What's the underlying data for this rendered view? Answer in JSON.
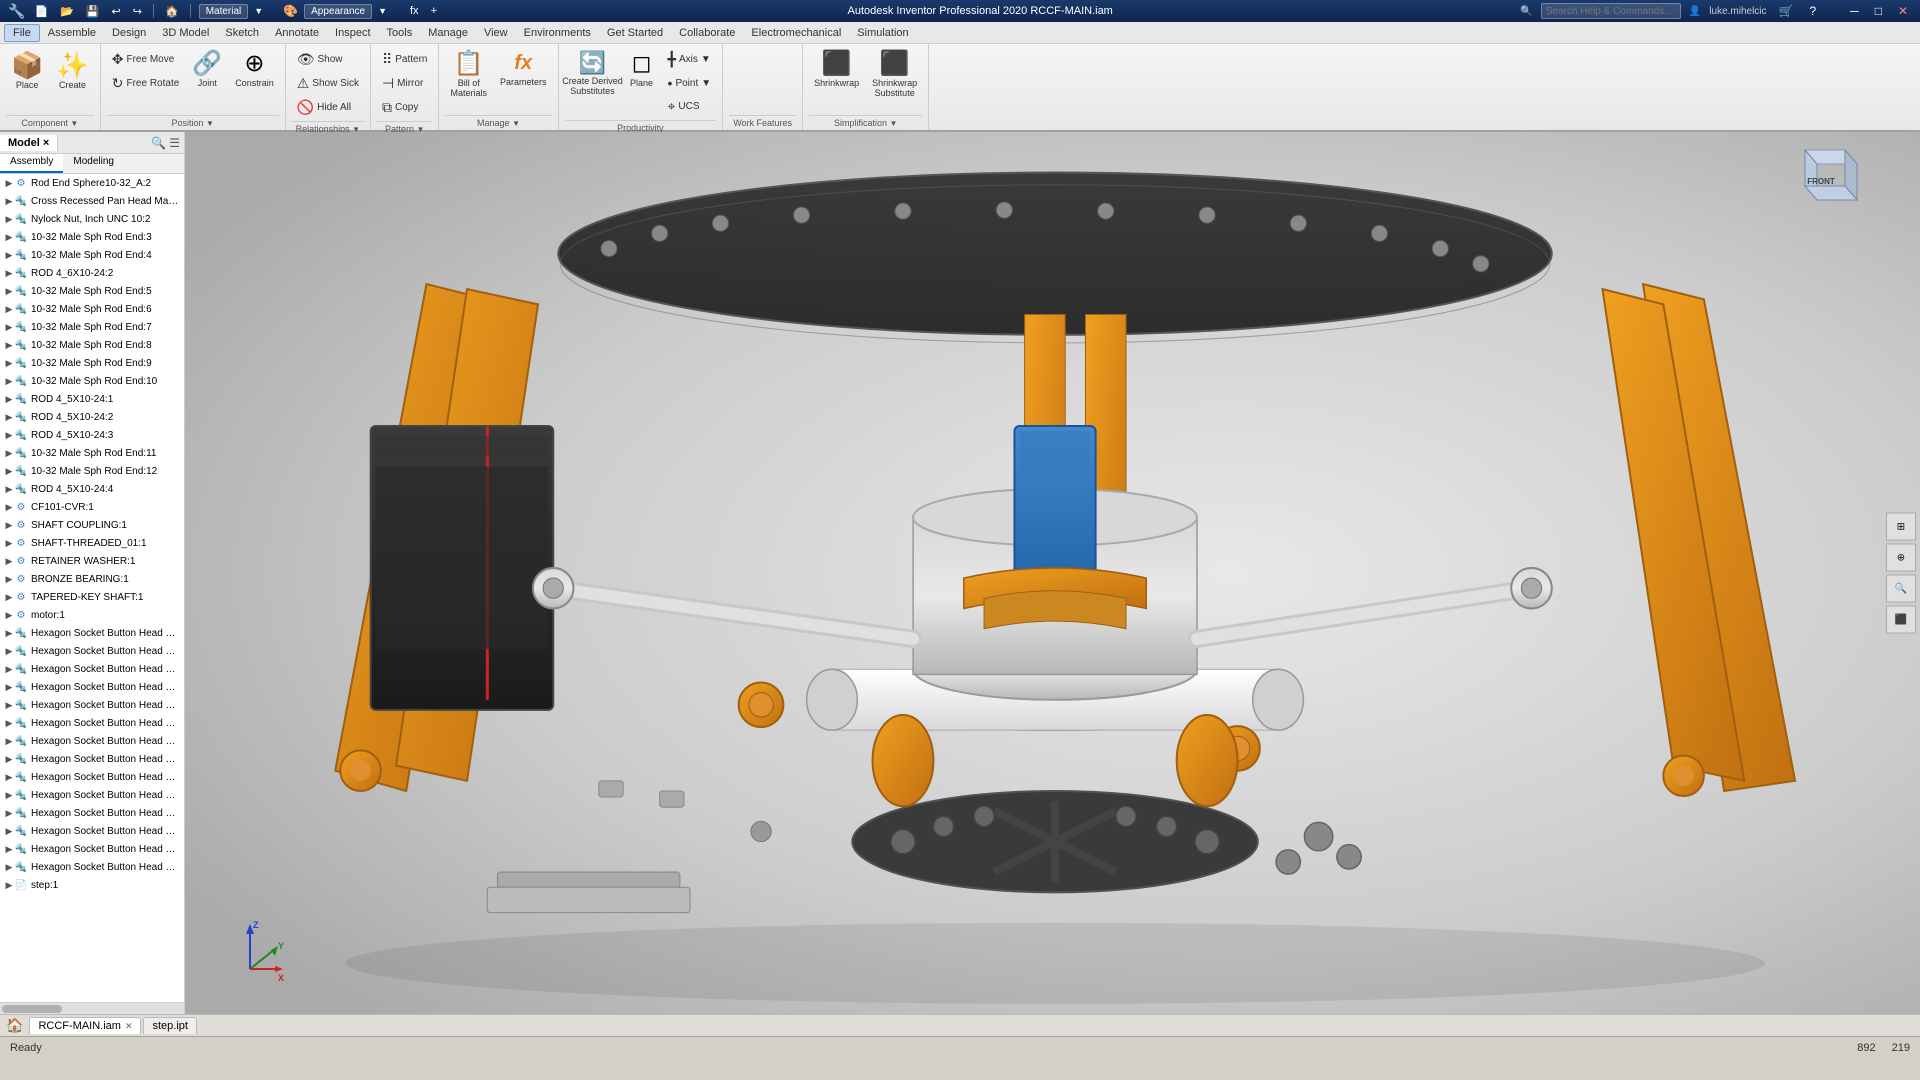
{
  "titlebar": {
    "title": "Autodesk Inventor Professional 2020  RCCF-MAIN.iam",
    "material_label": "Material",
    "appearance_label": "Appearance",
    "search_placeholder": "Search Help & Commands...",
    "username": "luke.mihelcic",
    "icons": [
      "💾",
      "📂",
      "↩",
      "↪",
      "🏠",
      "📋",
      "📊"
    ]
  },
  "menubar": {
    "items": [
      "File",
      "Assemble",
      "Design",
      "3D Model",
      "Sketch",
      "Annotate",
      "Inspect",
      "Tools",
      "Manage",
      "View",
      "Environments",
      "Get Started",
      "Collaborate",
      "Electromechanical",
      "Simulation"
    ]
  },
  "ribbon": {
    "groups": [
      {
        "name": "Component",
        "items": [
          {
            "label": "Place",
            "icon": "📦",
            "type": "big"
          },
          {
            "label": "Create",
            "icon": "✨",
            "type": "big"
          }
        ]
      },
      {
        "name": "Position",
        "items": [
          {
            "label": "Free Move",
            "icon": "✥",
            "type": "small"
          },
          {
            "label": "Free Rotate",
            "icon": "↻",
            "type": "small"
          },
          {
            "label": "Joint",
            "icon": "🔩",
            "type": "big"
          },
          {
            "label": "Constrain",
            "icon": "⊕",
            "type": "big"
          }
        ]
      },
      {
        "name": "Relationships",
        "items": [
          {
            "label": "Show",
            "icon": "👁",
            "type": "small"
          },
          {
            "label": "Show Sick",
            "icon": "⚠",
            "type": "small"
          },
          {
            "label": "Hide All",
            "icon": "🚫",
            "type": "small"
          }
        ]
      },
      {
        "name": "Pattern",
        "items": [
          {
            "label": "Pattern",
            "icon": "⠿",
            "type": "small"
          },
          {
            "label": "Mirror",
            "icon": "⊣",
            "type": "small"
          },
          {
            "label": "Copy",
            "icon": "⧉",
            "type": "small"
          }
        ]
      },
      {
        "name": "Manage",
        "items": [
          {
            "label": "Bill of\nMaterials",
            "icon": "📋",
            "type": "big"
          },
          {
            "label": "Parameters",
            "icon": "fx",
            "type": "big"
          }
        ]
      },
      {
        "name": "Productivity",
        "items": [
          {
            "label": "Create Derived\nSubstitutes",
            "icon": "🔄",
            "type": "big"
          },
          {
            "label": "Plane",
            "icon": "◻",
            "type": "big"
          },
          {
            "label": "Axis",
            "icon": "╋",
            "type": "small"
          },
          {
            "label": "Point",
            "icon": "•",
            "type": "small"
          },
          {
            "label": "UCS",
            "icon": "⌖",
            "type": "small"
          }
        ]
      },
      {
        "name": "Work Features",
        "label": "Work Features"
      },
      {
        "name": "Simplification",
        "items": [
          {
            "label": "Shrinkwrap",
            "icon": "⬛",
            "type": "big"
          },
          {
            "label": "Shrinkwrap\nSubstitute",
            "icon": "⬛",
            "type": "big"
          }
        ]
      }
    ]
  },
  "left_panel": {
    "tabs": [
      "Model ×",
      ""
    ],
    "sub_tabs": [
      "Assembly",
      "Modeling"
    ],
    "tree_items": [
      {
        "label": "Rod End Sphere10-32_A:2",
        "icon": "⚙",
        "depth": 0
      },
      {
        "label": "Cross Recessed Pan Head Machine Scr",
        "icon": "🔩",
        "depth": 0
      },
      {
        "label": "Nylock Nut, Inch UNC 10:2",
        "icon": "🔩",
        "depth": 0
      },
      {
        "label": "10-32 Male Sph Rod End:3",
        "icon": "🔩",
        "depth": 0
      },
      {
        "label": "10-32 Male Sph Rod End:4",
        "icon": "🔩",
        "depth": 0
      },
      {
        "label": "ROD 4_6X10-24:2",
        "icon": "🔩",
        "depth": 0
      },
      {
        "label": "10-32 Male Sph Rod End:5",
        "icon": "🔩",
        "depth": 0
      },
      {
        "label": "10-32 Male Sph Rod End:6",
        "icon": "🔩",
        "depth": 0
      },
      {
        "label": "10-32 Male Sph Rod End:7",
        "icon": "🔩",
        "depth": 0
      },
      {
        "label": "10-32 Male Sph Rod End:8",
        "icon": "🔩",
        "depth": 0
      },
      {
        "label": "10-32 Male Sph Rod End:9",
        "icon": "🔩",
        "depth": 0
      },
      {
        "label": "10-32 Male Sph Rod End:10",
        "icon": "🔩",
        "depth": 0
      },
      {
        "label": "ROD 4_5X10-24:1",
        "icon": "🔩",
        "depth": 0
      },
      {
        "label": "ROD 4_5X10-24:2",
        "icon": "🔩",
        "depth": 0
      },
      {
        "label": "ROD 4_5X10-24:3",
        "icon": "🔩",
        "depth": 0
      },
      {
        "label": "10-32 Male Sph Rod End:11",
        "icon": "🔩",
        "depth": 0
      },
      {
        "label": "10-32 Male Sph Rod End:12",
        "icon": "🔩",
        "depth": 0
      },
      {
        "label": "ROD 4_5X10-24:4",
        "icon": "🔩",
        "depth": 0
      },
      {
        "label": "CF101-CVR:1",
        "icon": "⚙",
        "depth": 0
      },
      {
        "label": "SHAFT COUPLING:1",
        "icon": "⚙",
        "depth": 0
      },
      {
        "label": "SHAFT-THREADED_01:1",
        "icon": "⚙",
        "depth": 0
      },
      {
        "label": "RETAINER WASHER:1",
        "icon": "⚙",
        "depth": 0
      },
      {
        "label": "BRONZE BEARING:1",
        "icon": "⚙",
        "depth": 0
      },
      {
        "label": "TAPERED-KEY SHAFT:1",
        "icon": "⚙",
        "depth": 0
      },
      {
        "label": "motor:1",
        "icon": "⚙",
        "depth": 0
      },
      {
        "label": "Hexagon Socket Button Head Cap Scre",
        "icon": "🔩",
        "depth": 0
      },
      {
        "label": "Hexagon Socket Button Head Cap Scre",
        "icon": "🔩",
        "depth": 0
      },
      {
        "label": "Hexagon Socket Button Head Cap Scre",
        "icon": "🔩",
        "depth": 0
      },
      {
        "label": "Hexagon Socket Button Head Cap Scre",
        "icon": "🔩",
        "depth": 0
      },
      {
        "label": "Hexagon Socket Button Head Cap Scre",
        "icon": "🔩",
        "depth": 0
      },
      {
        "label": "Hexagon Socket Button Head Cap Scre",
        "icon": "🔩",
        "depth": 0
      },
      {
        "label": "Hexagon Socket Button Head Cap Scre",
        "icon": "🔩",
        "depth": 0
      },
      {
        "label": "Hexagon Socket Button Head Cap Scre",
        "icon": "🔩",
        "depth": 0
      },
      {
        "label": "Hexagon Socket Button Head Cap Scre",
        "icon": "🔩",
        "depth": 0
      },
      {
        "label": "Hexagon Socket Button Head Cap Scre",
        "icon": "🔩",
        "depth": 0
      },
      {
        "label": "Hexagon Socket Button Head Cap Scre",
        "icon": "🔩",
        "depth": 0
      },
      {
        "label": "Hexagon Socket Button Head Cap Scre",
        "icon": "🔩",
        "depth": 0
      },
      {
        "label": "Hexagon Socket Button Head Cap Scre",
        "icon": "🔩",
        "depth": 0
      },
      {
        "label": "Hexagon Socket Button Head Cap Scre",
        "icon": "🔩",
        "depth": 0
      },
      {
        "label": "step:1",
        "icon": "📄",
        "depth": 0
      }
    ]
  },
  "bottom_tabs": [
    {
      "label": "RCCF-MAIN.iam",
      "active": true
    },
    {
      "label": "step.ipt",
      "active": false
    }
  ],
  "statusbar": {
    "status": "Ready",
    "coords": "892",
    "coords2": "219"
  },
  "viewport": {
    "view_label": "FRONT",
    "axis": {
      "x_label": "X",
      "y_label": "Y",
      "z_label": "Z"
    }
  }
}
